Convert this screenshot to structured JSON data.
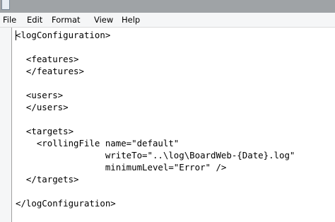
{
  "menu": {
    "items": [
      "File",
      "Edit",
      "Format",
      "View",
      "Help"
    ]
  },
  "editor": {
    "lines": [
      "<logConfiguration>",
      "",
      "  <features>",
      "  </features>",
      "",
      "  <users>",
      "  </users>",
      "",
      "  <targets>",
      "    <rollingFile name=\"default\"",
      "                 writeTo=\"..\\log\\BoardWeb-{Date}.log\"",
      "                 minimumLevel=\"Error\" />",
      "  </targets>",
      "",
      "</logConfiguration>"
    ]
  }
}
